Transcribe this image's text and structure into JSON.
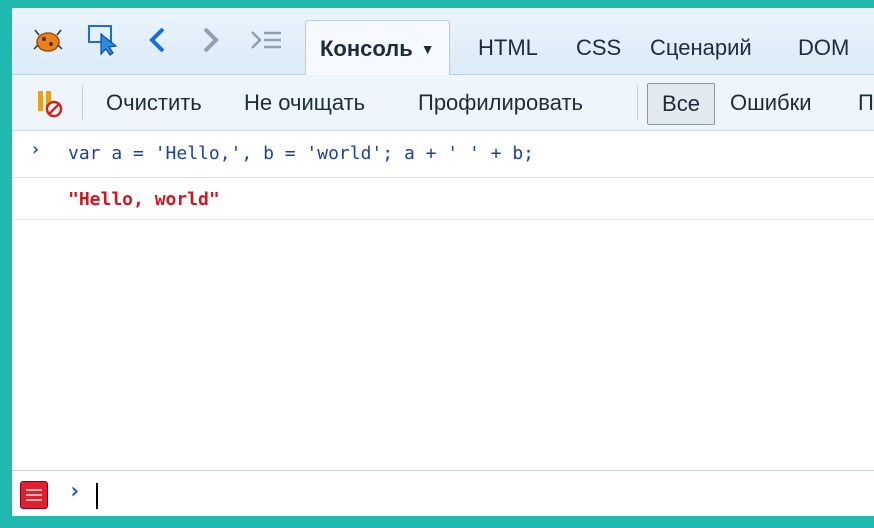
{
  "toolbar": {
    "icons": [
      "firebug-icon",
      "inspect-icon",
      "back-icon",
      "forward-icon",
      "command-editor-icon"
    ],
    "tabs": [
      {
        "label": "Консоль",
        "active": true
      },
      {
        "label": "HTML"
      },
      {
        "label": "CSS"
      },
      {
        "label": "Сценарий"
      },
      {
        "label": "DOM"
      }
    ]
  },
  "console_toolbar": {
    "clear_label": "Очистить",
    "persist_label": "Не очищать",
    "profile_label": "Профилировать",
    "filter_all_label": "Все",
    "filter_errors_label": "Ошибки",
    "filter_more_label": "П"
  },
  "log": {
    "prompt_symbol": "›",
    "command": "var a = 'Hello,', b = 'world'; a + ' ' + b;",
    "result": "\"Hello, world\""
  },
  "command_line": {
    "prompt_symbol": "›",
    "value": ""
  },
  "colors": {
    "accent_frame": "#1fb9b0",
    "command_text": "#1a3fa8",
    "result_text": "#d8141e"
  }
}
